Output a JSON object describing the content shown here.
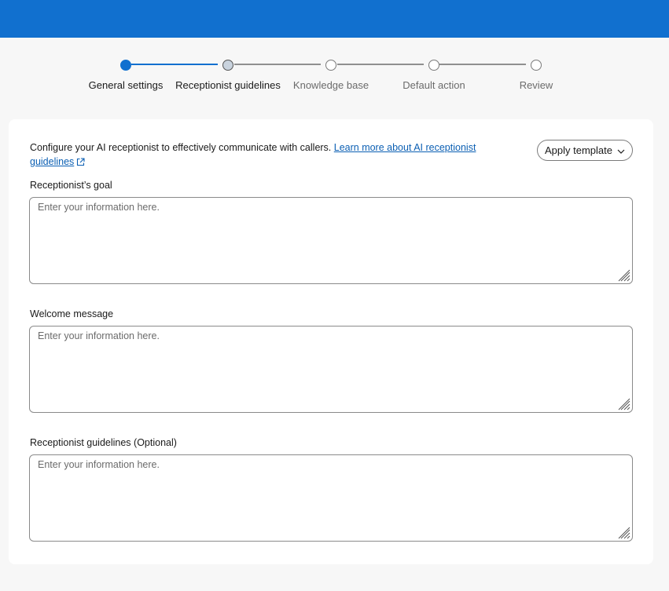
{
  "stepper": {
    "steps": [
      {
        "label": "General settings",
        "state": "done"
      },
      {
        "label": "Receptionist guidelines",
        "state": "current"
      },
      {
        "label": "Knowledge base",
        "state": "todo"
      },
      {
        "label": "Default action",
        "state": "todo"
      },
      {
        "label": "Review",
        "state": "todo"
      }
    ]
  },
  "intro": {
    "text": "Configure your AI receptionist to effectively communicate with callers. ",
    "link_text": "Learn more about AI receptionist guidelines",
    "link_icon": "external-link-icon"
  },
  "apply_template": {
    "label": "Apply template",
    "icon": "chevron-down-icon"
  },
  "fields": [
    {
      "label": "Receptionist’s goal",
      "value": "",
      "placeholder": "Enter your information here."
    },
    {
      "label": "Welcome message",
      "value": "",
      "placeholder": "Enter your information here."
    },
    {
      "label": "Receptionist guidelines (Optional)",
      "value": "",
      "placeholder": "Enter your information here."
    }
  ],
  "colors": {
    "brand_blue": "#1170cf",
    "link_blue": "#0b5fb3"
  }
}
